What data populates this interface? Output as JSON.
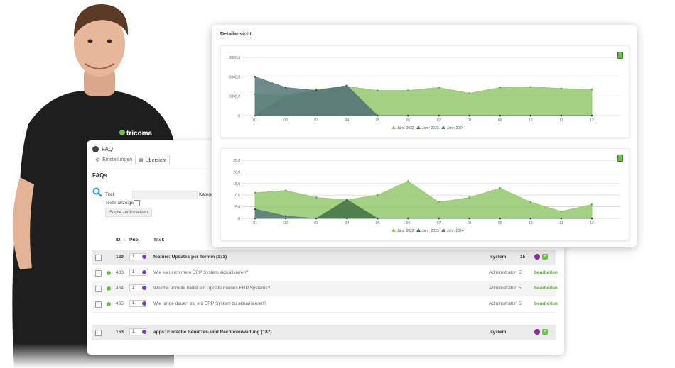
{
  "faq_panel": {
    "header_title": "FAQ",
    "tabs": [
      {
        "label": "Einstellungen",
        "active": false
      },
      {
        "label": "Übersicht",
        "active": true
      }
    ],
    "section_title": "FAQs",
    "filters": {
      "title_label": "Titel:",
      "category_label": "Katego",
      "show_texts_label": "Texte anzeigen:",
      "reset_button": "Suche zurücksetzen"
    },
    "columns": {
      "id": "ID:",
      "prio": "Prio:",
      "title": "Titel:"
    },
    "rows": [
      {
        "type": "group",
        "id": "139",
        "prio": "1",
        "title": "feature: Updates per Termin (173)",
        "user": "system",
        "count": "15"
      },
      {
        "type": "item",
        "id": "483",
        "prio": "1",
        "title": "Wie kann ich mein ERP System aktualisieren?",
        "user": "Administrator",
        "count": "5",
        "action": "bearbeiten"
      },
      {
        "type": "item",
        "id": "484",
        "prio": "1",
        "title": "Welche Vorteile bietet ein Update meines ERP Systems?",
        "user": "Administrator",
        "count": "5",
        "action": "bearbeiten"
      },
      {
        "type": "item",
        "id": "485",
        "prio": "1",
        "title": "Wie lange dauert es, ein ERP System zu aktualisieren?",
        "user": "Administrator",
        "count": "5",
        "action": "bearbeiten"
      },
      {
        "type": "group",
        "id": "153",
        "prio": "1",
        "title": "apps: Einfache Benutzer- und Rechteverwaltung (187)",
        "user": "system",
        "count": ""
      }
    ]
  },
  "shirt_logo": "tricoma",
  "detail_panel": {
    "title": "Detailansicht"
  },
  "colors": {
    "y2022": "#93c96c",
    "y2023": "#4a7a4a",
    "y2024": "#5d7c7c",
    "accent_green": "#6cc04a",
    "purple": "#7a3fc2"
  },
  "chart_data": [
    {
      "type": "area",
      "categories": [
        "01",
        "02",
        "03",
        "04",
        "05",
        "06",
        "07",
        "08",
        "09",
        "10",
        "11",
        "12"
      ],
      "ylim": [
        0,
        3000
      ],
      "yticks": [
        "3000,0",
        "2000,0",
        "1000,0",
        ",0"
      ],
      "series": [
        {
          "name": "Jahr: 2022",
          "values": [
            1100,
            1050,
            1350,
            1500,
            1300,
            1300,
            1450,
            1150,
            1450,
            1480,
            1400,
            1350
          ]
        },
        {
          "name": "Jahr: 2023",
          "values": [
            0,
            1000,
            1250,
            1550,
            0,
            0,
            0,
            0,
            0,
            0,
            0,
            0
          ]
        },
        {
          "name": "Jahr: 2024",
          "values": [
            2000,
            1450,
            1300,
            1550,
            0,
            0,
            0,
            0,
            0,
            0,
            0,
            0
          ]
        }
      ],
      "legend": "bottom-center"
    },
    {
      "type": "area",
      "categories": [
        "01",
        "02",
        "03",
        "04",
        "05",
        "06",
        "07",
        "08",
        "09",
        "10",
        "11",
        "12"
      ],
      "ylim": [
        0,
        25
      ],
      "yticks": [
        "25,0",
        "20,0",
        "15,0",
        "10,0",
        "5,0",
        ",0"
      ],
      "series": [
        {
          "name": "Jahr: 2022",
          "values": [
            11,
            12,
            9,
            8,
            10,
            16,
            7,
            9,
            13,
            7,
            3,
            6
          ]
        },
        {
          "name": "Jahr: 2023",
          "values": [
            0,
            0,
            0,
            8,
            0,
            0,
            0,
            0,
            0,
            0,
            0,
            0
          ]
        },
        {
          "name": "Jahr: 2024",
          "values": [
            4,
            1,
            0,
            0,
            0,
            0,
            0,
            0,
            0,
            0,
            0,
            0
          ]
        }
      ],
      "legend": "bottom-center"
    }
  ]
}
